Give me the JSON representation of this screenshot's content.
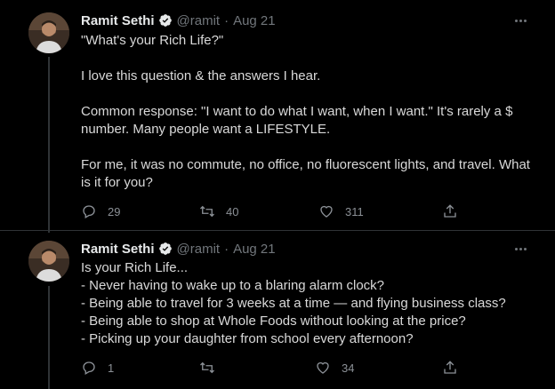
{
  "tweets": [
    {
      "author": "Ramit Sethi",
      "handle": "@ramit",
      "separator": "·",
      "date": "Aug 21",
      "paragraphs": [
        "\"What's your Rich Life?\"",
        "I love this question & the answers I hear.",
        "Common response: \"I want to do what I want, when I want.\" It's rarely a $ number. Many people want a LIFESTYLE.",
        "For me, it was no commute, no office, no fluorescent lights, and travel. What is it for you?"
      ],
      "replies": "29",
      "retweets": "40",
      "likes": "311"
    },
    {
      "author": "Ramit Sethi",
      "handle": "@ramit",
      "separator": "·",
      "date": "Aug 21",
      "lines": [
        "Is your Rich Life...",
        "- Never having to wake up to a blaring alarm clock?",
        "- Being able to travel for 3 weeks at a time — and flying business class?",
        "- Being able to shop at Whole Foods without looking at the price?",
        "- Picking up your daughter from school every afternoon?"
      ],
      "replies": "1",
      "retweets": "",
      "likes": "34"
    }
  ],
  "icons": {
    "verified": "verified-badge-icon",
    "more": "more-icon",
    "reply": "reply-icon",
    "retweet": "retweet-icon",
    "like": "like-icon",
    "share": "share-icon"
  },
  "colors": {
    "background": "#000000",
    "text": "#d9d9d9",
    "muted": "#71767b",
    "line": "#2f3336"
  }
}
